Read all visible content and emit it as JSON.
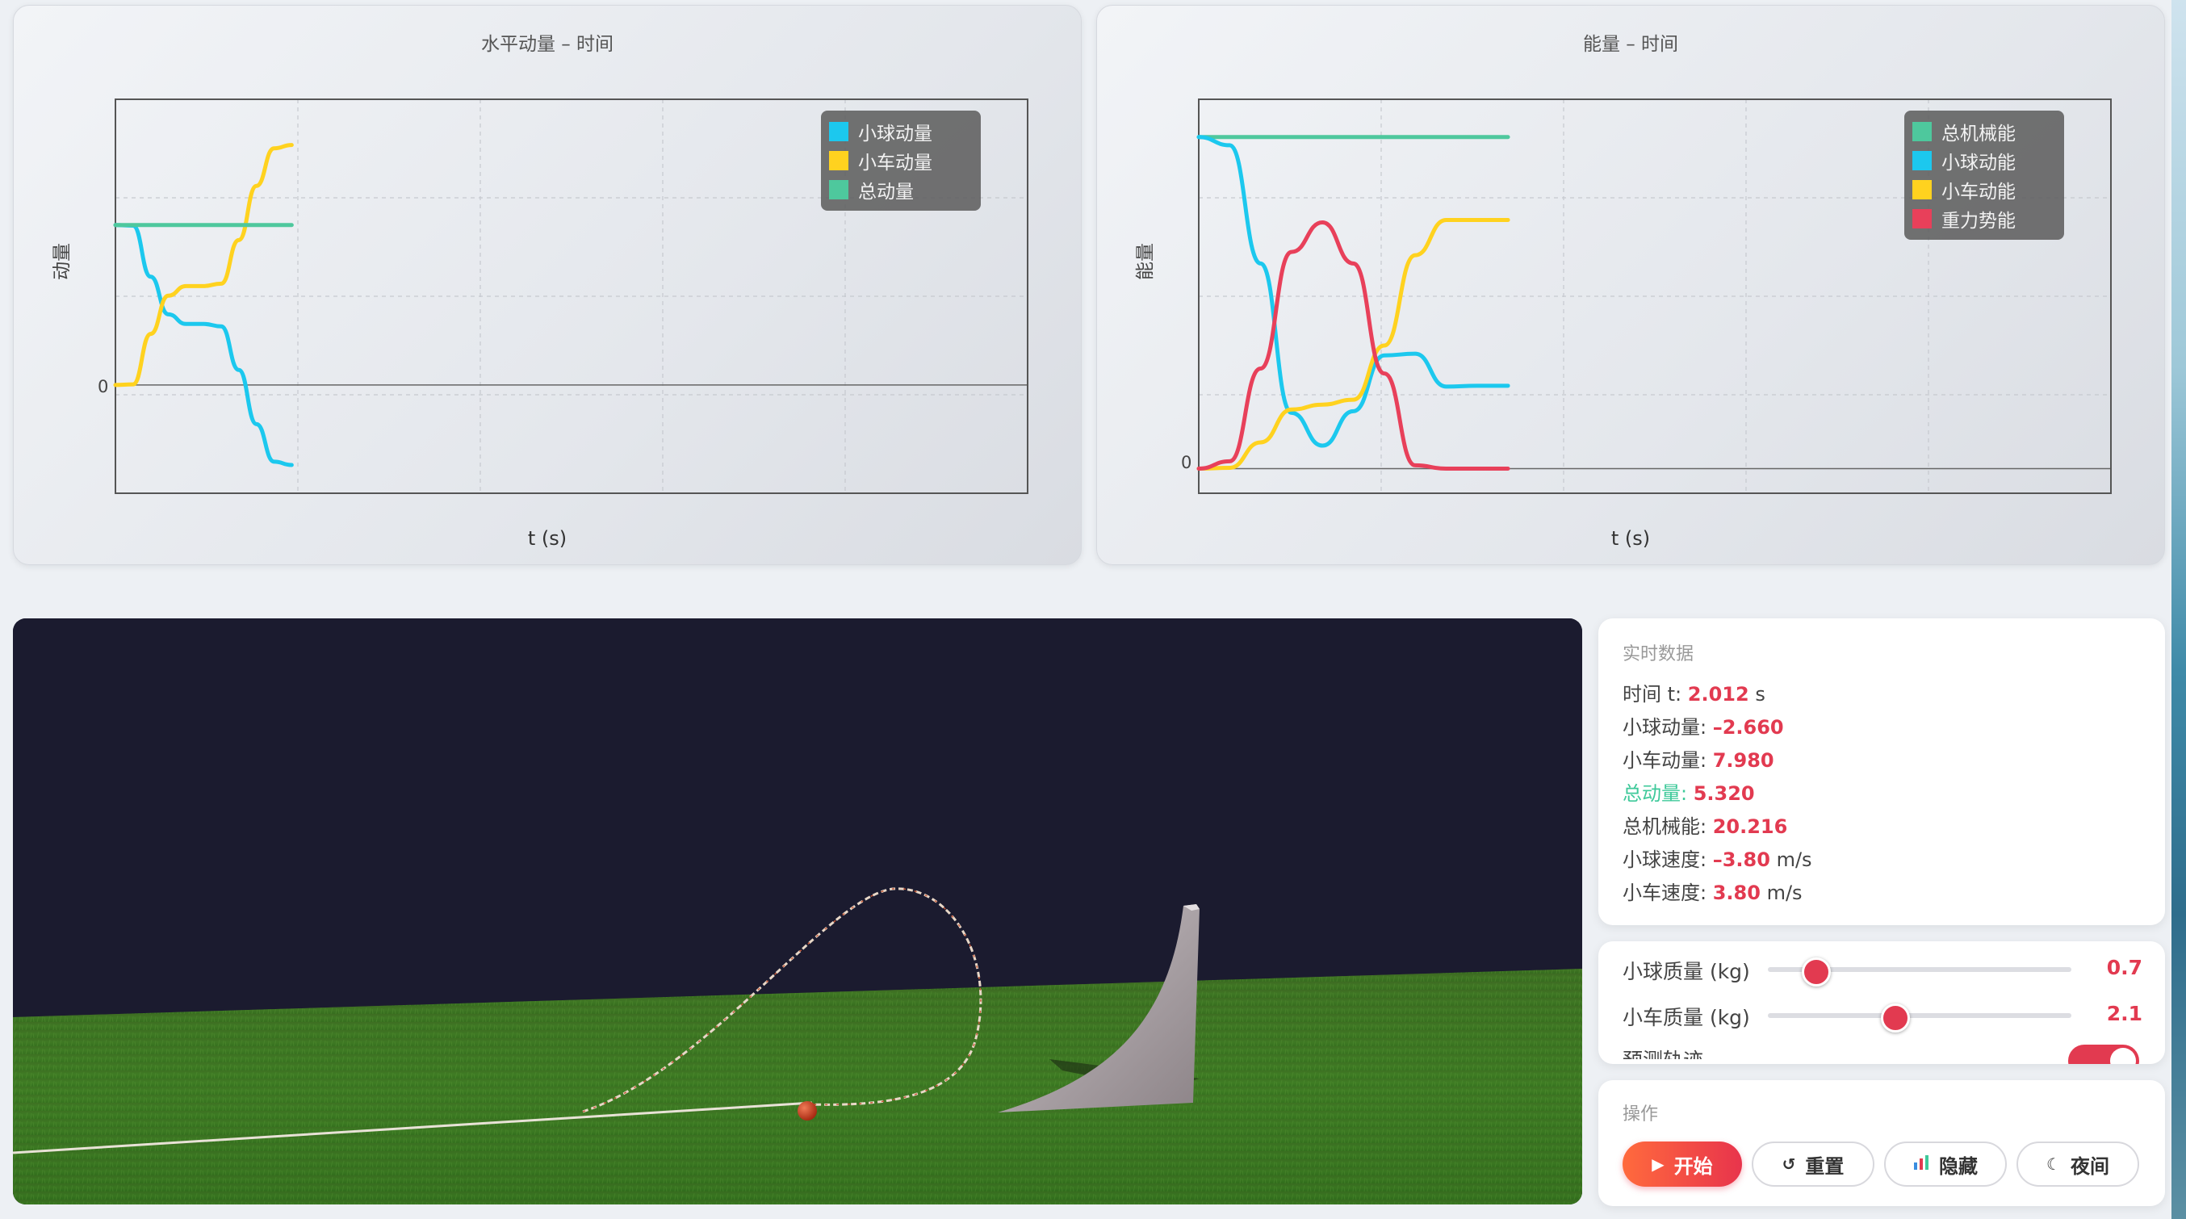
{
  "momentum_chart": {
    "title": "水平动量 – 时间",
    "ylabel": "动量",
    "xlabel": "t (s)",
    "zero_label": "0",
    "legend": [
      {
        "label": "小球动量",
        "color": "#1cc8ee"
      },
      {
        "label": "小车动量",
        "color": "#ffd21f"
      },
      {
        "label": "总动量",
        "color": "#4ec89d"
      }
    ]
  },
  "energy_chart": {
    "title": "能量 – 时间",
    "ylabel": "能量",
    "xlabel": "t (s)",
    "zero_label": "0",
    "legend": [
      {
        "label": "总机械能",
        "color": "#4ec89d"
      },
      {
        "label": "小球动能",
        "color": "#1cc8ee"
      },
      {
        "label": "小车动能",
        "color": "#ffd21f"
      },
      {
        "label": "重力势能",
        "color": "#e8405a"
      }
    ]
  },
  "chart_data": [
    {
      "type": "line",
      "title": "水平动量 – 时间",
      "xlabel": "t (s)",
      "ylabel": "动量",
      "x": [
        0,
        0.2,
        0.4,
        0.6,
        0.8,
        1.0,
        1.2,
        1.4,
        1.6,
        1.8,
        2.0
      ],
      "series": [
        {
          "name": "小球动量",
          "color": "#1cc8ee",
          "values": [
            5.32,
            5.3,
            3.6,
            2.35,
            2.03,
            2.03,
            1.95,
            0.5,
            -1.3,
            -2.55,
            -2.66
          ]
        },
        {
          "name": "小车动量",
          "color": "#ffd21f",
          "values": [
            0.0,
            0.02,
            1.7,
            2.97,
            3.29,
            3.29,
            3.37,
            4.82,
            6.62,
            7.87,
            7.98
          ]
        },
        {
          "name": "总动量",
          "color": "#4ec89d",
          "values": [
            5.32,
            5.32,
            5.32,
            5.32,
            5.32,
            5.32,
            5.32,
            5.32,
            5.32,
            5.32,
            5.32
          ]
        }
      ],
      "grid": true,
      "legend_position": "top-right"
    },
    {
      "type": "line",
      "title": "能量 – 时间",
      "xlabel": "t (s)",
      "ylabel": "能量",
      "x": [
        0,
        0.2,
        0.4,
        0.6,
        0.8,
        1.0,
        1.2,
        1.4,
        1.6,
        1.8,
        2.0
      ],
      "series": [
        {
          "name": "总机械能",
          "color": "#4ec89d",
          "values": [
            20.2,
            20.2,
            20.2,
            20.2,
            20.2,
            20.2,
            20.2,
            20.2,
            20.2,
            20.2,
            20.2
          ]
        },
        {
          "name": "小球动能",
          "color": "#1cc8ee",
          "values": [
            20.2,
            19.7,
            12.5,
            3.4,
            1.4,
            3.5,
            6.9,
            7.0,
            5.0,
            5.05,
            5.05
          ]
        },
        {
          "name": "小车动能",
          "color": "#ffd21f",
          "values": [
            0.0,
            0.05,
            1.6,
            3.6,
            3.9,
            4.2,
            7.5,
            13.0,
            15.15,
            15.15,
            15.15
          ]
        },
        {
          "name": "重力势能",
          "color": "#e8405a",
          "values": [
            0.0,
            0.45,
            6.1,
            13.2,
            15.0,
            12.5,
            5.8,
            0.2,
            0.0,
            0.0,
            0.0
          ]
        }
      ],
      "grid": true,
      "legend_position": "top-right"
    }
  ],
  "realtime": {
    "heading": "实时数据",
    "rows": [
      {
        "label": "时间 t: ",
        "value": "2.012",
        "unit": " s"
      },
      {
        "label": "小球动量: ",
        "value": "–2.660",
        "unit": ""
      },
      {
        "label": "小车动量: ",
        "value": "7.980",
        "unit": ""
      },
      {
        "label": "总动量: ",
        "value": "5.320",
        "unit": ""
      },
      {
        "label": "总机械能: ",
        "value": "20.216",
        "unit": ""
      },
      {
        "label": "小球速度: ",
        "value": "–3.80",
        "unit": " m/s"
      },
      {
        "label": "小车速度: ",
        "value": "3.80",
        "unit": " m/s"
      }
    ]
  },
  "params": {
    "ball_mass": {
      "label": "小球质量 (kg)",
      "value": "0.7",
      "fraction": 0.16
    },
    "cart_mass": {
      "label": "小车质量 (kg)",
      "value": "2.1",
      "fraction": 0.42
    },
    "trajectory_label": "预测轨迹",
    "trajectory_on": true
  },
  "actions": {
    "heading": "操作",
    "start": "开始",
    "reset": "重置",
    "hide": "隐藏",
    "night": "夜间",
    "start_icon": "play-icon",
    "reset_icon": "reset-icon",
    "hide_icon": "bar-chart-icon",
    "night_icon": "moon-icon"
  },
  "colors": {
    "accent": "#e23a50",
    "ball": "#1cc8ee",
    "cart": "#ffd21f",
    "total": "#4ec89d",
    "potential": "#e8405a"
  }
}
